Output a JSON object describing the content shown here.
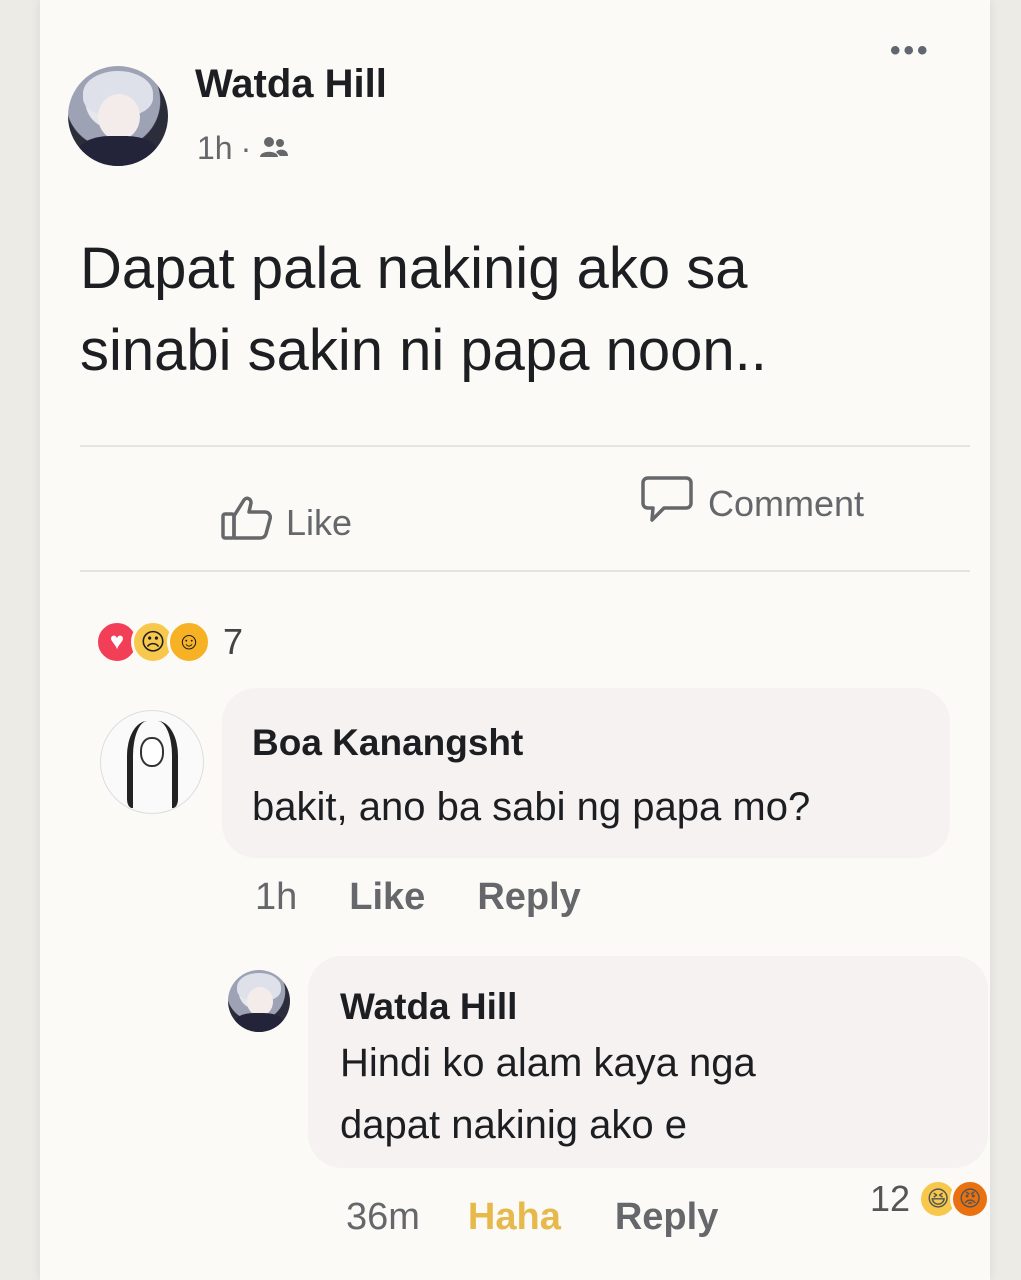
{
  "post": {
    "author": "Watda Hill",
    "time": "1h",
    "separator": "·",
    "audience_icon": "friends-icon",
    "more_icon": "•••",
    "text_line1": "Dapat pala nakinig ako sa",
    "text_line2": "sinabi sakin ni papa noon.."
  },
  "actions": {
    "like_label": "Like",
    "comment_label": "Comment"
  },
  "reactions": {
    "types": [
      "love",
      "sad",
      "care"
    ],
    "count": "7"
  },
  "comments": [
    {
      "author": "Boa Kanangsht",
      "text": "bakit, ano ba sabi ng papa mo?",
      "time": "1h",
      "like_label": "Like",
      "reply_label": "Reply"
    },
    {
      "author": "Watda Hill",
      "text_line1": "Hindi ko alam kaya nga",
      "text_line2": "dapat nakinig ako e",
      "time": "36m",
      "reaction_label": "Haha",
      "reply_label": "Reply",
      "reaction_count": "12",
      "reaction_types": [
        "haha",
        "angry"
      ]
    }
  ],
  "colors": {
    "haha_label": "#e7b84a",
    "meta_gray": "#65676b",
    "bubble": "#f6f2f2"
  }
}
